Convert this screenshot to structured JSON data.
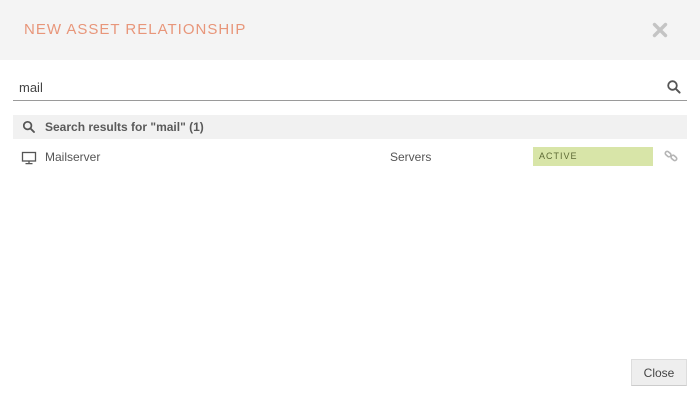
{
  "dialog": {
    "title": "NEW ASSET RELATIONSHIP",
    "close_icon": "close-x-icon"
  },
  "search": {
    "value": "mail",
    "placeholder": "",
    "icon": "search-icon"
  },
  "results": {
    "header_icon": "search-icon",
    "header_text": "Search results for \"mail\" (1)",
    "items": [
      {
        "icon": "monitor-icon",
        "name": "Mailserver",
        "category": "Servers",
        "status": "ACTIVE",
        "action_icon": "link-icon"
      }
    ]
  },
  "footer": {
    "close_label": "Close"
  },
  "colors": {
    "title": "#e8967a",
    "header_bg": "#f4f4f4",
    "status_active_bg": "#d8e5a8",
    "status_active_text": "#5d6a35"
  }
}
